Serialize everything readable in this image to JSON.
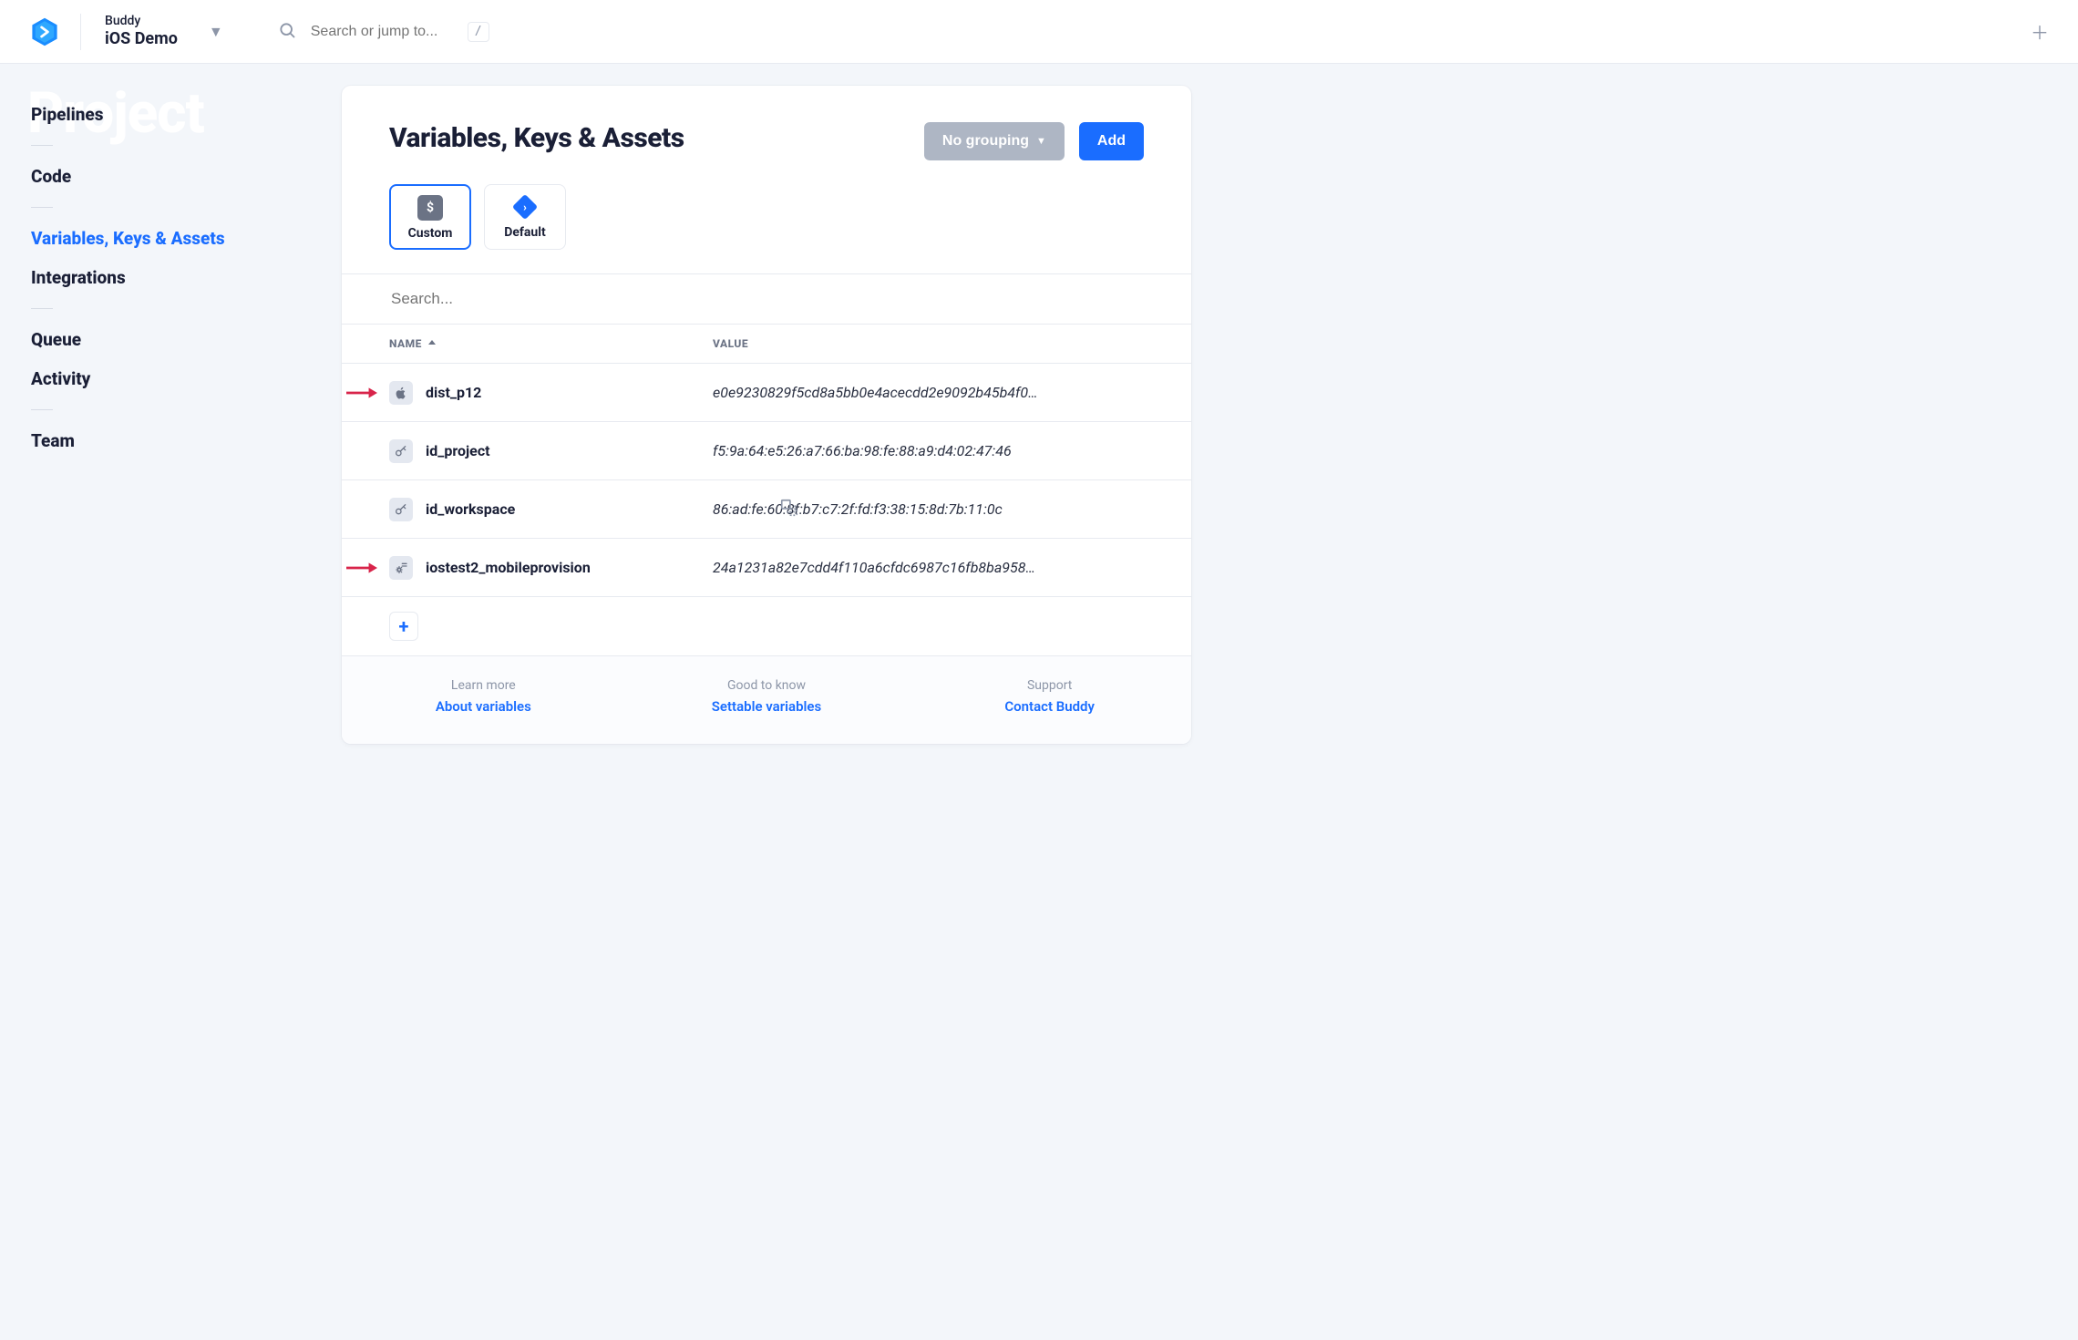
{
  "brand": {
    "org": "Buddy",
    "project": "iOS Demo"
  },
  "search": {
    "placeholder": "Search or jump to...",
    "shortcut": "/"
  },
  "ghost": "Project",
  "nav": {
    "pipelines": "Pipelines",
    "code": "Code",
    "variables": "Variables, Keys & Assets",
    "integrations": "Integrations",
    "queue": "Queue",
    "activity": "Activity",
    "team": "Team"
  },
  "page": {
    "title": "Variables, Keys & Assets",
    "grouping_label": "No grouping",
    "add_label": "Add",
    "tabs": {
      "custom": "Custom",
      "default": "Default"
    },
    "var_search_placeholder": "Search...",
    "col_name": "NAME",
    "col_value": "VALUE"
  },
  "rows": [
    {
      "name": "dist_p12",
      "value": "e0e9230829f5cd8a5bb0e4acecdd2e9092b45b4f0…",
      "icon": "apple",
      "arrow": true,
      "dup": false
    },
    {
      "name": "id_project",
      "value": "f5:9a:64:e5:26:a7:66:ba:98:fe:88:a9:d4:02:47:46",
      "icon": "key",
      "arrow": false,
      "dup": false
    },
    {
      "name": "id_workspace",
      "value": "86:ad:fe:60:8f:b7:c7:2f:fd:f3:38:15:8d:7b:11:0c",
      "icon": "key",
      "arrow": false,
      "dup": true
    },
    {
      "name": "iostest2_mobileprovision",
      "value": "24a1231a82e7cdd4f110a6cfdc6987c16fb8ba958…",
      "icon": "gear",
      "arrow": true,
      "dup": false
    }
  ],
  "footer": {
    "c1t": "Learn more",
    "c1l": "About variables",
    "c2t": "Good to know",
    "c2l": "Settable variables",
    "c3t": "Support",
    "c3l": "Contact Buddy"
  }
}
